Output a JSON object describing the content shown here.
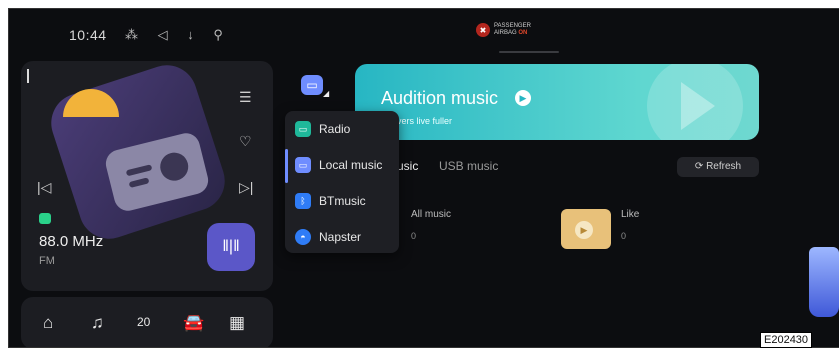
{
  "status": {
    "time": "10:44",
    "icons": "⁂ ◁ ↓ ⚲",
    "airbag_line1": "PASSENGER",
    "airbag_line2": "AIRBAG",
    "airbag_state": "ON"
  },
  "radio": {
    "frequency": "88.0 MHz",
    "band": "FM"
  },
  "banner": {
    "title": "Audition music",
    "subtitle": "ic lovers live fuller"
  },
  "tabs": {
    "local_tab_partial": "usic",
    "usb_tab": "USB music"
  },
  "refresh_label": "Refresh",
  "tiles": [
    {
      "label": "All music",
      "count": "0"
    },
    {
      "label": "Like",
      "count": "0"
    }
  ],
  "source_menu": {
    "items": [
      {
        "label": "Radio"
      },
      {
        "label": "Local music"
      },
      {
        "label": "BTmusic"
      },
      {
        "label": "Napster"
      }
    ]
  },
  "dock": {
    "temp": "20"
  },
  "ref_code": "E202430",
  "colors": {
    "accent": "#6f8dff",
    "banner": "#27b6c3",
    "folder_tile": "#e8c17a",
    "play_button": "#5b57c8"
  }
}
